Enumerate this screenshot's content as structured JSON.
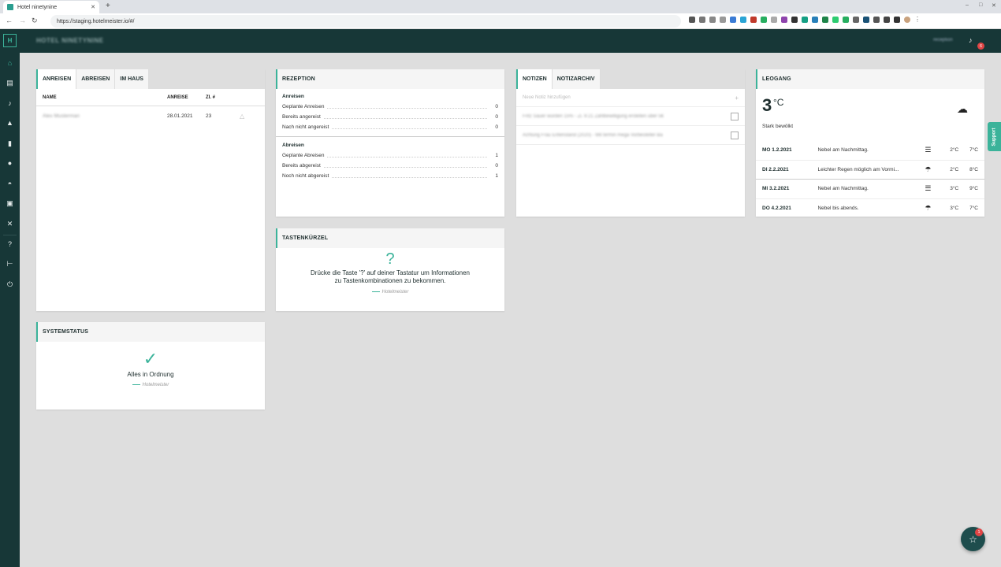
{
  "browser": {
    "tab_title": "Hotel ninetynine",
    "url": "https://staging.hotelmeister.io/#/",
    "win_min": "–",
    "win_max": "□",
    "win_close": "✕"
  },
  "app": {
    "logo": "H",
    "hotel_name": "HOTEL NINETYNINE",
    "user_name": "reception",
    "notification_count": "6"
  },
  "sidebar": {
    "items": [
      {
        "icon": "home-icon",
        "glyph": "⌂"
      },
      {
        "icon": "bed-icon",
        "glyph": "▤"
      },
      {
        "icon": "bell-icon",
        "glyph": "♪"
      },
      {
        "icon": "service-icon",
        "glyph": "▲"
      },
      {
        "icon": "document-icon",
        "glyph": "▮"
      },
      {
        "icon": "person-icon",
        "glyph": "●"
      },
      {
        "icon": "dashboard-icon",
        "glyph": "◓"
      },
      {
        "icon": "wallet-icon",
        "glyph": "▣"
      },
      {
        "icon": "tools-icon",
        "glyph": "✕"
      },
      {
        "icon": "help-icon",
        "glyph": "?"
      },
      {
        "icon": "hotelmeister-icon",
        "glyph": "⊢"
      },
      {
        "icon": "power-icon",
        "glyph": "⏻"
      }
    ]
  },
  "arrivals": {
    "tabs": [
      "ANREISEN",
      "ABREISEN",
      "IM HAUS"
    ],
    "columns": {
      "name": "NAME",
      "arrival": "ANREISE",
      "room": "ZI. #"
    },
    "rows": [
      {
        "name": "Alex Musterman",
        "arrival": "28.01.2021",
        "room": "23"
      }
    ]
  },
  "reception": {
    "title": "REZEPTION",
    "arrivals_title": "Anreisen",
    "arrivals": [
      {
        "label": "Geplante Anreisen",
        "value": "0"
      },
      {
        "label": "Bereits angereist",
        "value": "0"
      },
      {
        "label": "Nach nicht angereist",
        "value": "0"
      }
    ],
    "departures_title": "Abreisen",
    "departures": [
      {
        "label": "Geplante Abreisen",
        "value": "1"
      },
      {
        "label": "Bereits abgereist",
        "value": "0"
      },
      {
        "label": "Noch nicht abgereist",
        "value": "1"
      }
    ]
  },
  "notes": {
    "tabs": [
      "NOTIZEN",
      "NOTIZARCHIV"
    ],
    "placeholder": "Neue Notiz hinzufügen",
    "add": "+",
    "items": [
      "Fritz Sauer wurden 15% - Zi. 9:21 Zahlbewilligung erstellen über 5€",
      "Achtung Frau Entenstand (2020) - Mit termin mega Vorbesteller Ba"
    ]
  },
  "shortcuts": {
    "title": "TASTENKÜRZEL",
    "glyph": "?",
    "line1": "Drücke die Taste '?' auf deiner Tastatur um Informationen",
    "line2": "zu Tastenkombinationen zu bekommen.",
    "signature": "Hotelmeister"
  },
  "weather": {
    "title": "LEOGANG",
    "current_temp": "3",
    "unit": "°C",
    "condition": "Stark bewölkt",
    "forecast": [
      {
        "date": "MO 1.2.2021",
        "text": "Nebel am Nachmittag.",
        "icon": "fog-icon",
        "glyph": "☰",
        "lo": "2°C",
        "hi": "7°C"
      },
      {
        "date": "DI 2.2.2021",
        "text": "Leichter Regen möglich am Vormi...",
        "icon": "rain-icon",
        "glyph": "☂",
        "lo": "2°C",
        "hi": "8°C"
      },
      {
        "date": "MI 3.2.2021",
        "text": "Nebel am Nachmittag.",
        "icon": "fog-icon",
        "glyph": "☰",
        "lo": "3°C",
        "hi": "9°C"
      },
      {
        "date": "DO 4.2.2021",
        "text": "Nebel bis abends.",
        "icon": "rain-icon",
        "glyph": "☂",
        "lo": "3°C",
        "hi": "7°C"
      }
    ]
  },
  "system": {
    "title": "SYSTEMSTATUS",
    "check": "✓",
    "status": "Alles in Ordnung",
    "signature": "Hotelmeister"
  },
  "support": {
    "label": "Support"
  },
  "fab": {
    "badge": "1",
    "glyph": "☆"
  },
  "colors": {
    "accent": "#3bb39a",
    "sidebar": "#173737",
    "background": "#dedede"
  }
}
